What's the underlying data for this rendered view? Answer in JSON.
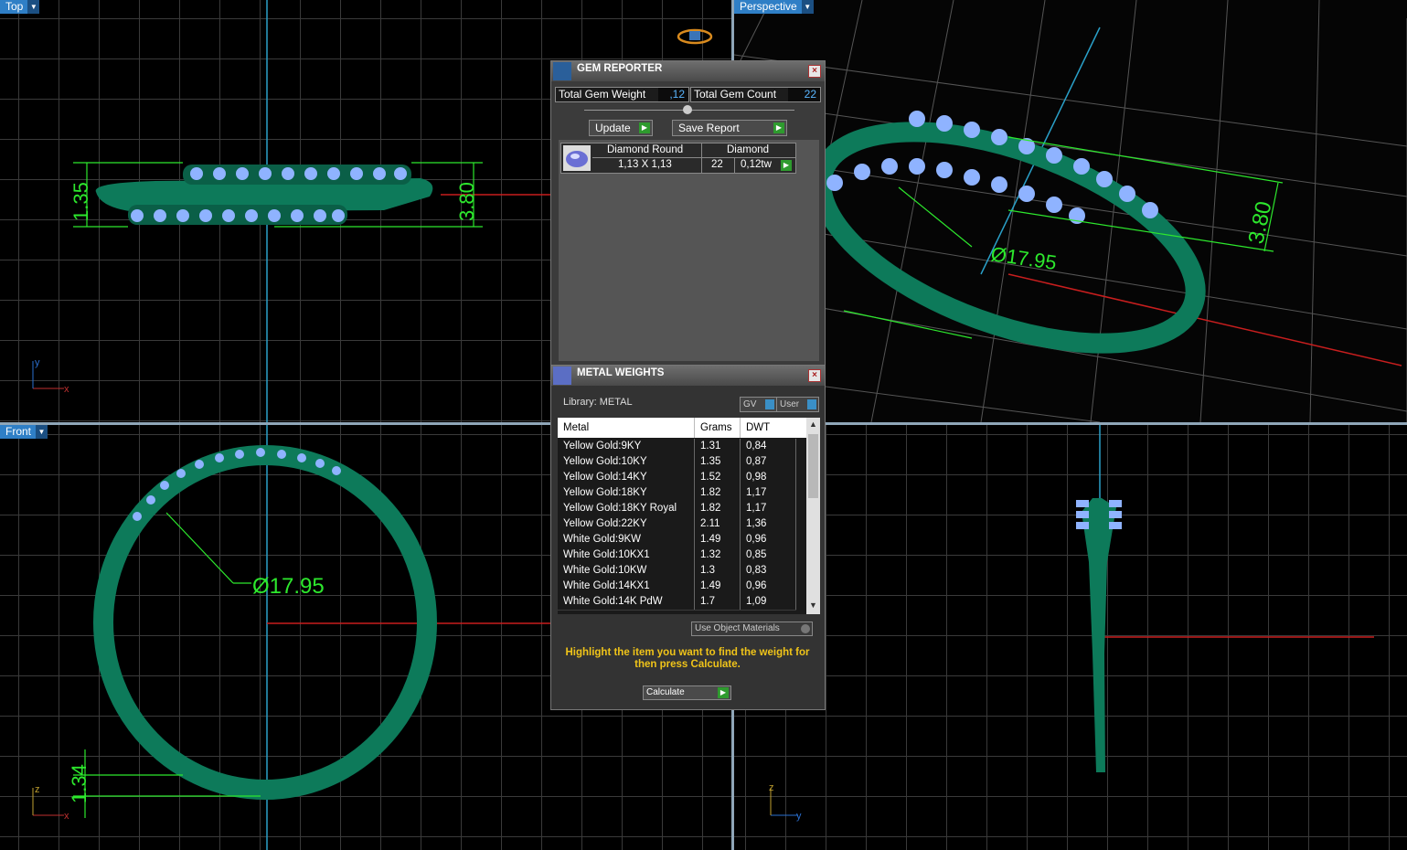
{
  "viewports": {
    "top": {
      "label": "Top"
    },
    "perspective": {
      "label": "Perspective"
    },
    "front": {
      "label": "Front"
    }
  },
  "dimensions": {
    "top_height": "1.35",
    "top_width": "3.80",
    "persp_width": "3.80",
    "persp_diameter": "Ø17.95",
    "front_diameter": "Ø17.95",
    "front_thickness": "1.34"
  },
  "axes": {
    "x": "x",
    "y": "y",
    "z": "z"
  },
  "gem_reporter": {
    "title": "GEM REPORTER",
    "total_weight_label": "Total Gem Weight",
    "total_weight_value": ",12",
    "total_count_label": "Total Gem Count",
    "total_count_value": "22",
    "update_label": "Update",
    "save_report_label": "Save Report",
    "gem": {
      "shape": "Diamond Round",
      "size": "1,13 X 1,13",
      "material": "Diamond",
      "count": "22",
      "weight": "0,12tw"
    }
  },
  "metal_weights": {
    "title": "METAL WEIGHTS",
    "library_label": "Library: METAL",
    "gv_label": "GV",
    "user_label": "User",
    "columns": [
      "Metal",
      "Grams",
      "DWT"
    ],
    "rows": [
      [
        "Yellow Gold:9KY",
        "1.31",
        "0,84"
      ],
      [
        "Yellow Gold:10KY",
        "1.35",
        "0,87"
      ],
      [
        "Yellow Gold:14KY",
        "1.52",
        "0,98"
      ],
      [
        "Yellow Gold:18KY",
        "1.82",
        "1,17"
      ],
      [
        "Yellow Gold:18KY Royal",
        "1.82",
        "1,17"
      ],
      [
        "Yellow Gold:22KY",
        "2.11",
        "1,36"
      ],
      [
        "White Gold:9KW",
        "1.49",
        "0,96"
      ],
      [
        "White Gold:10KX1",
        "1.32",
        "0,85"
      ],
      [
        "White Gold:10KW",
        "1.3",
        "0,83"
      ],
      [
        "White Gold:14KX1",
        "1.49",
        "0,96"
      ],
      [
        "White Gold:14K PdW",
        "1.7",
        "1,09"
      ]
    ],
    "use_object_materials": "Use Object Materials",
    "hint": "Highlight the item you want to find the weight for then press Calculate.",
    "calculate_label": "Calculate"
  },
  "colors": {
    "ring": "#0d7a5a",
    "gem": "#8fb3ff",
    "dimension": "#2de82d",
    "viewport_label": "#2f7fc6"
  }
}
